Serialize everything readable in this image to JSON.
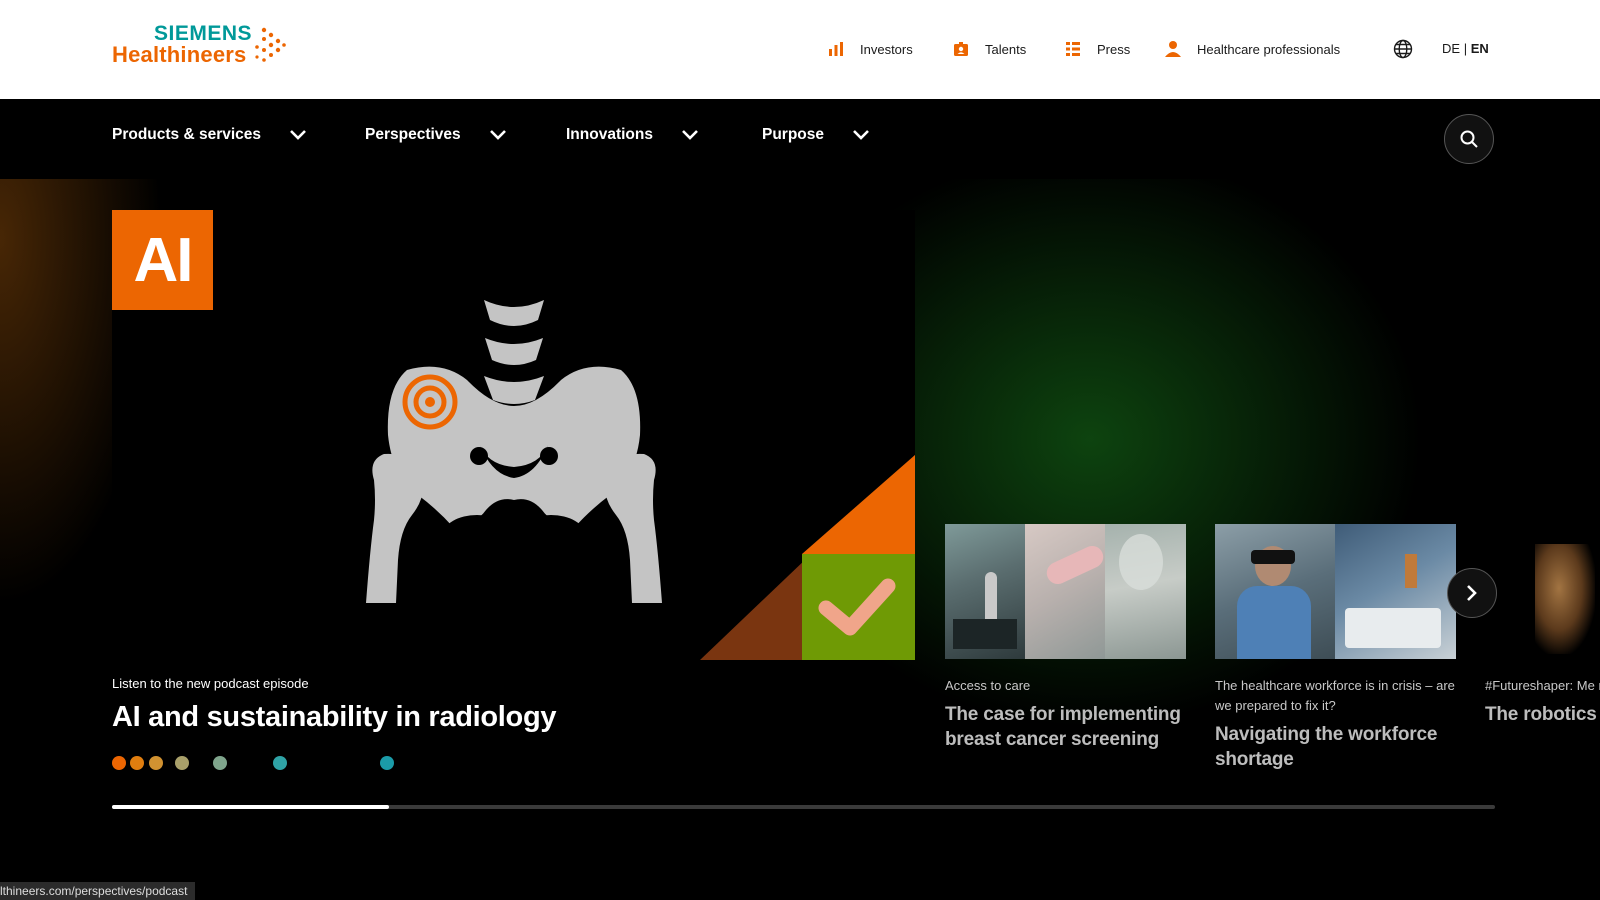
{
  "brand": {
    "line1": "SIEMENS",
    "line2": "Healthineers",
    "teal": "#009999",
    "orange": "#ec6602"
  },
  "utility_nav": [
    {
      "label": "Investors",
      "icon": "bar-chart-icon"
    },
    {
      "label": "Talents",
      "icon": "id-badge-icon"
    },
    {
      "label": "Press",
      "icon": "list-icon"
    },
    {
      "label": "Healthcare professionals",
      "icon": "person-icon"
    }
  ],
  "language": {
    "icon": "globe-icon",
    "de": "DE",
    "separator": "|",
    "en": "EN",
    "active": "EN"
  },
  "main_nav": [
    {
      "label": "Products & services"
    },
    {
      "label": "Perspectives"
    },
    {
      "label": "Innovations"
    },
    {
      "label": "Purpose"
    }
  ],
  "search": {
    "icon": "search-icon"
  },
  "hero": {
    "badge": "AI",
    "kicker": "Listen to the new podcast episode",
    "headline": "AI and sustainability in radiology",
    "dot_colors": [
      "#ec6602",
      "#e07e0f",
      "#d19231",
      "#a9a06a",
      "#7fa58c",
      "#2fa3a6",
      "#1b9ba8"
    ],
    "progress": 0.2
  },
  "cards": [
    {
      "kicker": "Access to care",
      "title": "The case for implementing breast cancer screening"
    },
    {
      "kicker": "The healthcare workforce is in crisis – are we prepared to fix it?",
      "title": "Navigating the workforce shortage"
    },
    {
      "kicker": "#Futureshaper: Me robots",
      "title": "The robotics i"
    }
  ],
  "carousel": {
    "next_icon": "chevron-right-icon"
  },
  "status_url": "lthineers.com/perspectives/podcast"
}
